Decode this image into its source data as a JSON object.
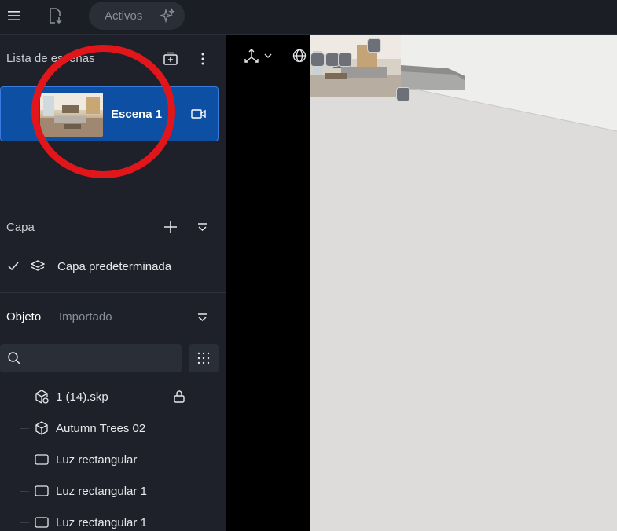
{
  "topbar": {
    "menu_icon": "hamburger-menu-icon",
    "import_icon": "file-import-icon",
    "assets_label": "Activos",
    "assets_icon": "sparkle-icon"
  },
  "scenes": {
    "title": "Lista de escenas",
    "items": [
      {
        "name": "Escena 1",
        "thumbnail": "scene-thumbnail-image",
        "camera_icon": "video-camera-icon"
      }
    ]
  },
  "layers": {
    "title": "Capa",
    "items": [
      {
        "name": "Capa predeterminada",
        "checked": true
      }
    ]
  },
  "objects": {
    "tabs": [
      "Objeto",
      "Importado"
    ],
    "active_tab": "Objeto",
    "search_placeholder": "",
    "items": [
      {
        "name": "1 (14).skp",
        "icon": "model-import-icon",
        "locked": true
      },
      {
        "name": "Autumn Trees 02",
        "icon": "cube-icon",
        "locked": false
      },
      {
        "name": "Luz rectangular",
        "icon": "rect-light-icon",
        "locked": false
      },
      {
        "name": "Luz rectangular 1",
        "icon": "rect-light-icon",
        "locked": false
      },
      {
        "name": "Luz rectangular 1",
        "icon": "rect-light-icon",
        "locked": false
      }
    ]
  },
  "colors": {
    "accent": "#0d4fa3",
    "annotation": "#e0161a",
    "sidebar_bg": "#1e2129"
  }
}
